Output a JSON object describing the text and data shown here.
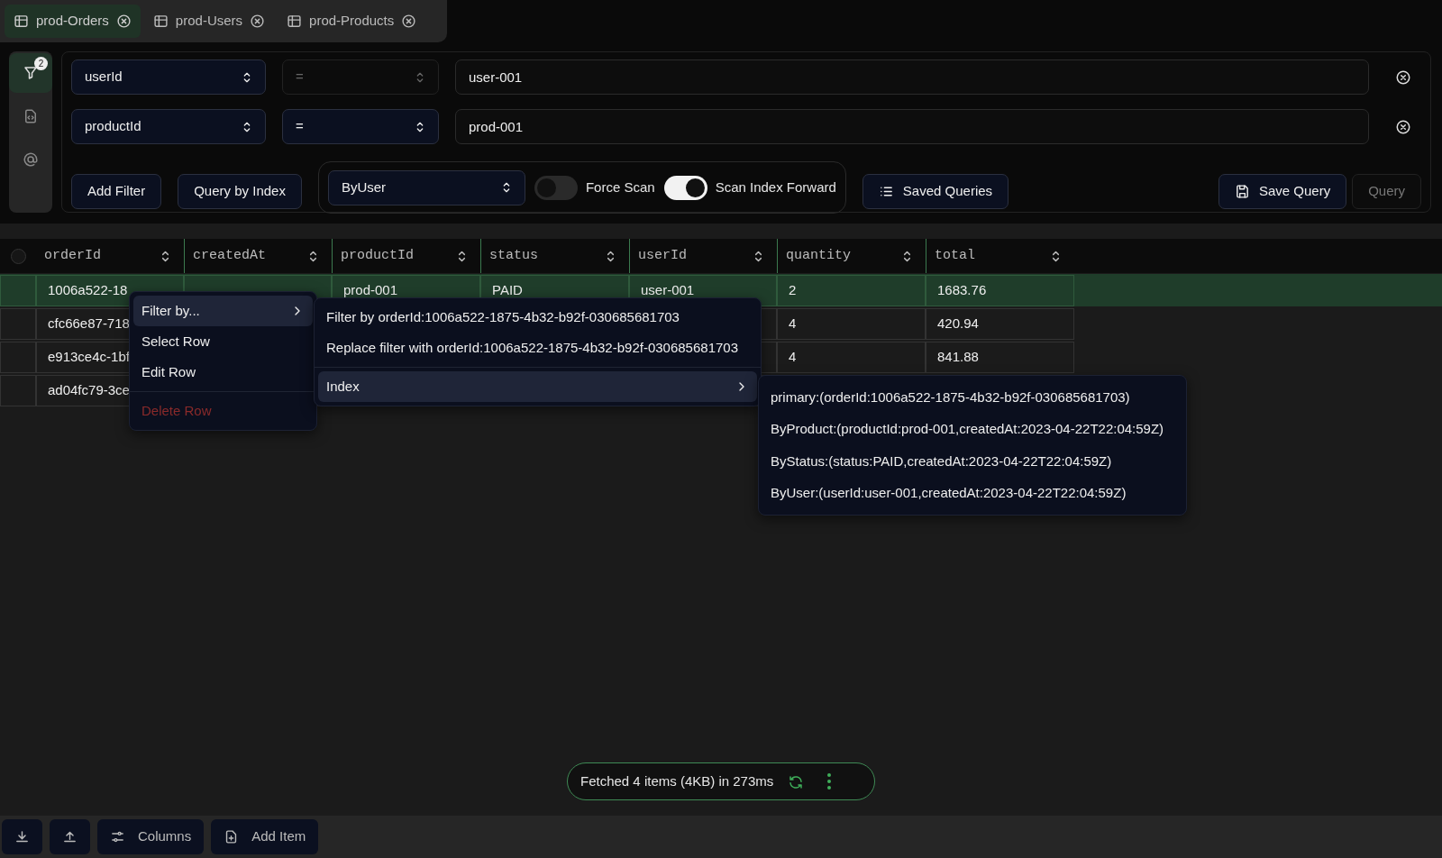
{
  "tabs": [
    {
      "label": "prod-Orders",
      "selected": true
    },
    {
      "label": "prod-Users",
      "selected": false
    },
    {
      "label": "prod-Products",
      "selected": false
    }
  ],
  "sidebar": {
    "items": [
      {
        "kind": "filter",
        "selected": true,
        "badge": "2"
      },
      {
        "kind": "code",
        "selected": false
      },
      {
        "kind": "at",
        "selected": false
      }
    ]
  },
  "filters": [
    {
      "attribute": "userId",
      "operator": "=",
      "operator_disabled": true,
      "value": "user-001"
    },
    {
      "attribute": "productId",
      "operator": "=",
      "operator_disabled": false,
      "value": "prod-001"
    }
  ],
  "toolbar": {
    "add_filter": "Add Filter",
    "query_by_index": "Query by Index",
    "index": "ByUser",
    "force_scan": {
      "label": "Force Scan",
      "on": false
    },
    "scan_forward": {
      "label": "Scan Index Forward",
      "on": true
    },
    "saved_queries": "Saved Queries",
    "save_query": "Save Query",
    "query": {
      "label": "Query",
      "disabled": true
    }
  },
  "table": {
    "all_selected": false,
    "columns": [
      "orderId",
      "createdAt",
      "productId",
      "status",
      "userId",
      "quantity",
      "total"
    ],
    "rows": [
      {
        "selected": true,
        "cells": [
          "1006a522-18",
          null,
          "prod-001",
          "PAID",
          "user-001",
          "2",
          "1683.76"
        ]
      },
      {
        "selected": false,
        "cells": [
          "cfc66e87-718",
          null,
          null,
          null,
          null,
          "4",
          "420.94"
        ]
      },
      {
        "selected": false,
        "cells": [
          "e913ce4c-1bf",
          null,
          null,
          null,
          null,
          "4",
          "841.88"
        ]
      },
      {
        "selected": false,
        "cells": [
          "ad04fc79-3ce",
          null,
          null,
          null,
          null,
          null,
          null
        ]
      }
    ]
  },
  "context_menu": [
    {
      "label": "Filter by...",
      "kind": "submenu",
      "highlighted": true
    },
    {
      "label": "Select Row",
      "kind": "item",
      "highlighted": false
    },
    {
      "label": "Edit Row",
      "kind": "item",
      "highlighted": false
    },
    {
      "label": "Delete Row",
      "kind": "danger",
      "highlighted": false
    }
  ],
  "filter_menu": [
    {
      "label": "Filter by orderId:1006a522-1875-4b32-b92f-030685681703",
      "kind": "item",
      "highlighted": false
    },
    {
      "label": "Replace filter with orderId:1006a522-1875-4b32-b92f-030685681703",
      "kind": "item",
      "highlighted": false
    },
    {
      "label": "Index",
      "kind": "submenu",
      "highlighted": true
    }
  ],
  "index_menu": [
    "primary:(orderId:1006a522-1875-4b32-b92f-030685681703)",
    "ByProduct:(productId:prod-001,createdAt:2023-04-22T22:04:59Z)",
    "ByStatus:(status:PAID,createdAt:2023-04-22T22:04:59Z)",
    "ByUser:(userId:user-001,createdAt:2023-04-22T22:04:59Z)"
  ],
  "status": "Fetched 4 items (4KB) in 273ms",
  "bottom_bar": [
    {
      "kind": "download"
    },
    {
      "kind": "upload"
    },
    {
      "kind": "columns",
      "label": "Columns"
    },
    {
      "kind": "add",
      "label": "Add Item"
    }
  ]
}
